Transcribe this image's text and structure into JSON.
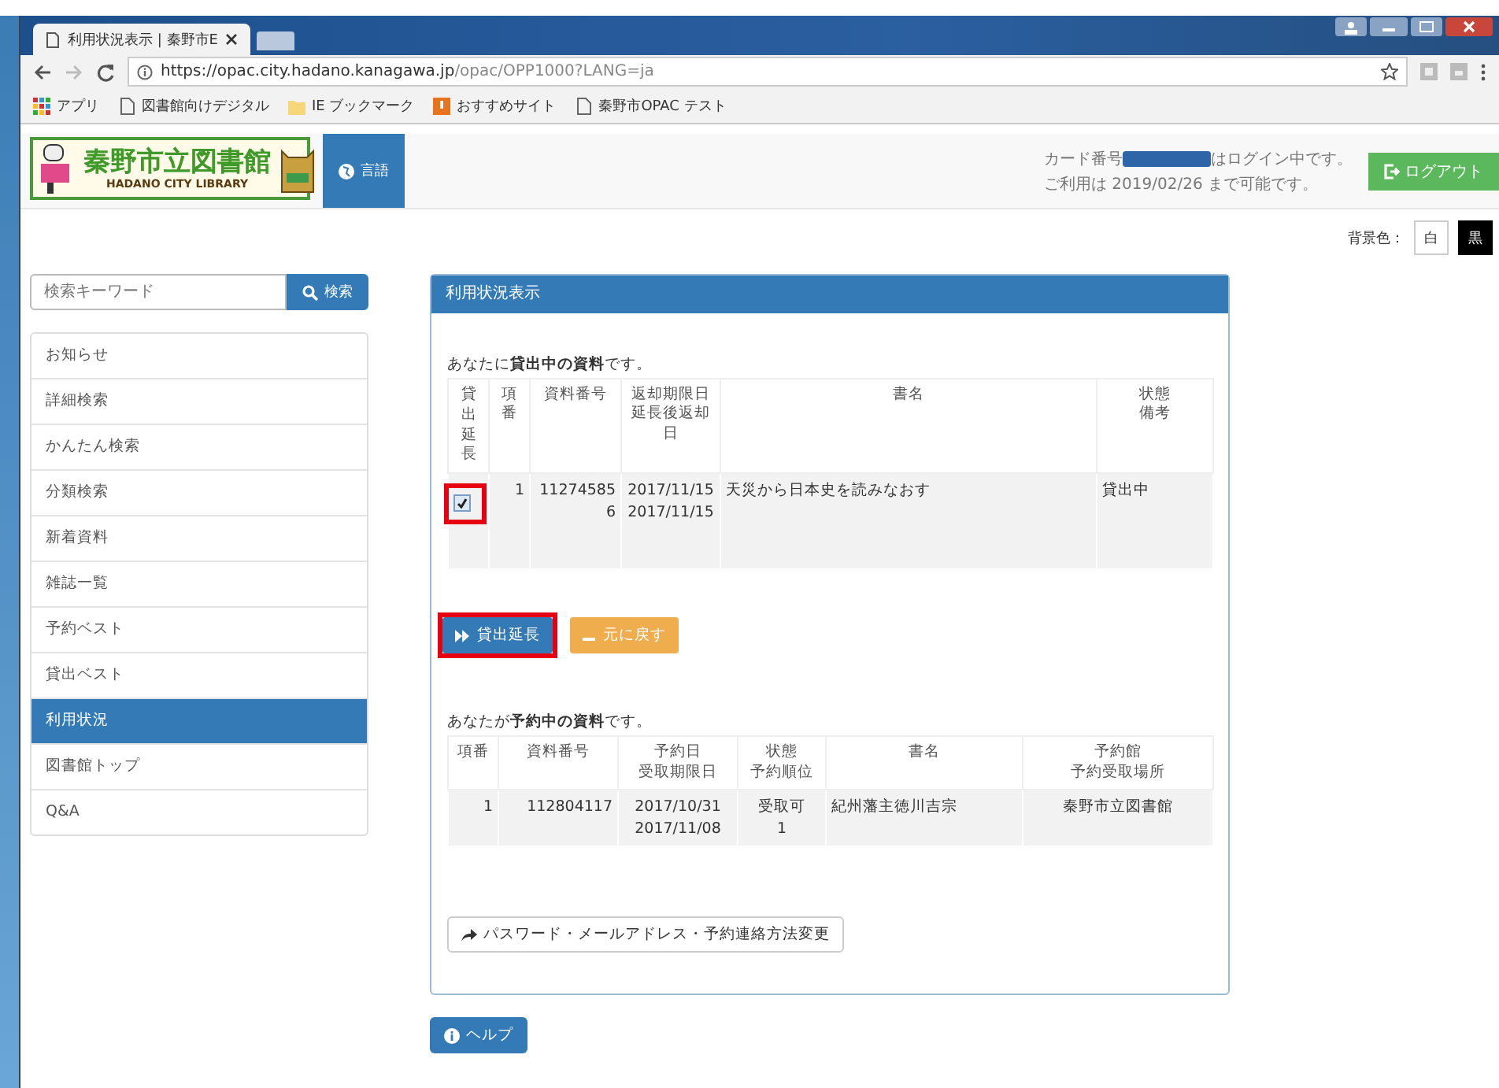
{
  "browser": {
    "tab_title": "利用状況表示 | 秦野市E",
    "url_host": "https://opac.city.hadano.kanagawa.jp",
    "url_path": "/opac/OPP1000?LANG=ja",
    "bookmarks": [
      {
        "label": "アプリ",
        "kind": "apps"
      },
      {
        "label": "図書館向けデジタル",
        "kind": "page"
      },
      {
        "label": "IE ブックマーク",
        "kind": "folder"
      },
      {
        "label": "おすすめサイト",
        "kind": "site"
      },
      {
        "label": "秦野市OPAC テスト",
        "kind": "page"
      }
    ]
  },
  "header": {
    "logo_title": "秦野市立図書館",
    "logo_subtitle": "HADANO CITY LIBRARY",
    "language_button": "言語",
    "login_prefix": "カード番号",
    "login_suffix": "はログイン中です。",
    "expiry": "ご利用は 2019/02/26 まで可能です。",
    "logout_button": "ログアウト"
  },
  "theme": {
    "label": "背景色：",
    "options": [
      {
        "label": "白",
        "kind": "light"
      },
      {
        "label": "黒",
        "kind": "dark"
      }
    ]
  },
  "sidebar": {
    "search": {
      "placeholder": "検索キーワード",
      "button": "検索"
    },
    "items": [
      {
        "label": "お知らせ",
        "selected": false
      },
      {
        "label": "詳細検索",
        "selected": false
      },
      {
        "label": "かんたん検索",
        "selected": false
      },
      {
        "label": "分類検索",
        "selected": false
      },
      {
        "label": "新着資料",
        "selected": false
      },
      {
        "label": "雑誌一覧",
        "selected": false
      },
      {
        "label": "予約ベスト",
        "selected": false
      },
      {
        "label": "貸出ベスト",
        "selected": false
      },
      {
        "label": "利用状況",
        "selected": true
      },
      {
        "label": "図書館トップ",
        "selected": false
      },
      {
        "label": "Q&A",
        "selected": false
      }
    ]
  },
  "panel": {
    "title": "利用状況表示",
    "loans": {
      "caption": "あなたに**貸出中の資料**です。",
      "columns": [
        {
          "label": "貸出延長"
        },
        {
          "label": "項番"
        },
        {
          "label": "資料番号"
        },
        {
          "label": "返却期限日",
          "sublabel": "延長後返却日"
        },
        {
          "label": "書名"
        },
        {
          "label": "状態",
          "sublabel": "備考"
        }
      ],
      "rows": [
        {
          "checked": true,
          "highlighted": true,
          "cells": [
            "",
            "1",
            "112745856",
            "2017/11/15\n2017/11/15",
            "天災から日本史を読みなおす",
            "貸出中"
          ]
        }
      ]
    },
    "buttons": [
      {
        "label": "貸出延長",
        "kind": "primary",
        "highlighted": true
      },
      {
        "label": "元に戻す",
        "kind": "warning",
        "highlighted": false
      }
    ],
    "reservations": {
      "caption": "あなたが**予約中の資料**です。",
      "columns": [
        {
          "label": "項番"
        },
        {
          "label": "資料番号"
        },
        {
          "label": "予約日",
          "sublabel": "受取期限日"
        },
        {
          "label": "状態",
          "sublabel": "予約順位"
        },
        {
          "label": "書名"
        },
        {
          "label": "予約館",
          "sublabel": "予約受取場所"
        }
      ],
      "rows": [
        {
          "cells": [
            "1",
            "112804117",
            "2017/10/31\n2017/11/08",
            "受取可\n1",
            "紀州藩主徳川吉宗",
            "秦野市立図書館"
          ]
        }
      ]
    },
    "settings_button": "パスワード・メールアドレス・予約連絡方法変更"
  },
  "help_button": "ヘルプ"
}
